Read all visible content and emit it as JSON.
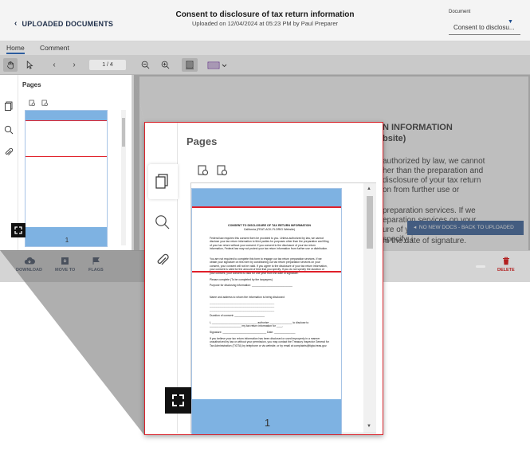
{
  "header": {
    "back_label": "UPLOADED DOCUMENTS",
    "title": "Consent to disclosure of tax return information",
    "subtitle": "Uploaded on 12/04/2024 at 05:23 PM by Paul Preparer",
    "document_label": "Document",
    "document_value": "Consent to disclosu..."
  },
  "tabs": [
    {
      "label": "Home",
      "active": true
    },
    {
      "label": "Comment",
      "active": false
    }
  ],
  "toolbar": {
    "page_indicator": "1 / 4"
  },
  "thumbnail_panel": {
    "title": "Pages",
    "page_number": "1"
  },
  "document_page": {
    "lines": [
      "N INFORMATION",
      "bsite)",
      "authorized by law, we cannot",
      "her than the preparation and",
      "disclosure of your tax return",
      "on from further use or",
      "preparation services. If we",
      "eparation services on your",
      "ure of your",
      "specify, i",
      "m the date of signature."
    ]
  },
  "notification": {
    "text": "NO NEW DOCS - BACK TO UPLOADED"
  },
  "bottom_actions": {
    "download": "DOWNLOAD",
    "move_to": "MOVE TO",
    "flags": "FLAGS",
    "delete": "DELETE"
  },
  "thumbnail_content": {
    "heading": "CONSENT TO DISCLOSURE OF TAX RETURN INFORMATION",
    "subheading": "California (FEAT-ACK-FLORIG Website)",
    "p1": "Federal law requires this consent form be provided to you. Unless authorized by law, we cannot disclose your tax return information to third parties for purposes other than the preparation and filing of your tax return without your consent. If you consent to the disclosure of your tax return information, Federal law may not protect your tax return information from further use or distribution.",
    "p2": "You are not required to complete this form to engage our tax return preparation services. If we obtain your signature on this form by conditioning our tax return preparation services on your consent, your consent will not be valid. If you agree to the disclosure of your tax return information, your consent is valid for the amount of time that you specify. If you do not specify the duration of your consent, your consent is valid for one year from the date of signature.",
    "p3": "Please complete (To be completed by the taxpayers)",
    "p4": "Purpose for disclosing information: ___________________________",
    "p5": "Name and address to whom the information is being disclosed:",
    "p6": "Duration of consent: ____________________",
    "p7": "I, ______________________________ authorize _______________ to disclose to _____________________ my tax return information for ____.",
    "p8": "Signature: _____________________________ Date: ______________",
    "p9": "If you believe your tax return information has been disclosed or used improperly in a manner unauthorized by law or without your permission, you may contact the Treasury Inspector General for Tax Administration (TIGTA) by telephone or via website, or by email at complaints@tigta.treas.gov."
  },
  "colors": {
    "brand_blue": "#1f4e8f",
    "highlight_red": "#d8252c",
    "delete_red": "#b21f1f",
    "thumb_blue": "#7eb2e2"
  }
}
